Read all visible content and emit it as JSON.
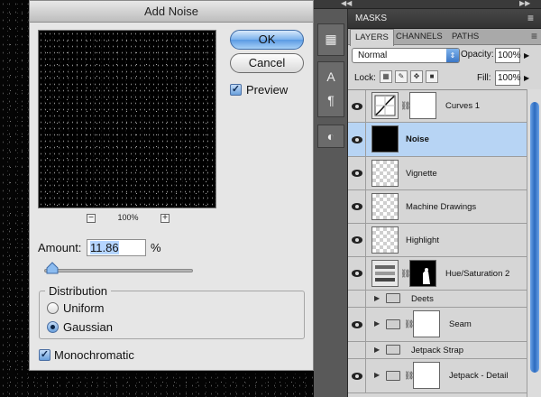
{
  "dialog": {
    "title": "Add Noise",
    "ok_label": "OK",
    "cancel_label": "Cancel",
    "preview_label": "Preview",
    "preview_checked": true,
    "zoom_level": "100%",
    "zoom_out_glyph": "−",
    "zoom_in_glyph": "+",
    "amount_label": "Amount:",
    "amount_value": "11.86",
    "amount_unit": "%",
    "amount_slider_fraction": 0.0297,
    "distribution_label": "Distribution",
    "uniform_label": "Uniform",
    "gaussian_label": "Gaussian",
    "selected_distribution": "Gaussian",
    "monochromatic_label": "Monochromatic",
    "monochromatic_checked": true
  },
  "panels": {
    "masks_label": "MASKS",
    "tabs": [
      "LAYERS",
      "CHANNELS",
      "PATHS"
    ],
    "active_tab": "LAYERS",
    "blend_mode": "Normal",
    "opacity_label": "Opacity:",
    "opacity_value": "100%",
    "lock_label": "Lock:",
    "fill_label": "Fill:",
    "fill_value": "100%"
  },
  "layers": [
    {
      "name": "Curves 1",
      "kind": "adjustment",
      "visible": true,
      "selected": false
    },
    {
      "name": "Noise",
      "kind": "fill-black",
      "visible": true,
      "selected": true
    },
    {
      "name": "Vignette",
      "kind": "transparent",
      "visible": true,
      "selected": false
    },
    {
      "name": "Machine Drawings",
      "kind": "transparent",
      "visible": true,
      "selected": false
    },
    {
      "name": "Highlight",
      "kind": "transparent",
      "visible": true,
      "selected": false
    },
    {
      "name": "Hue/Saturation 2",
      "kind": "adjustment",
      "visible": true,
      "selected": false
    },
    {
      "name": "Deets",
      "kind": "group",
      "visible": false,
      "selected": false
    },
    {
      "name": "Seam",
      "kind": "group-masked",
      "visible": true,
      "selected": false
    },
    {
      "name": "Jetpack Strap",
      "kind": "group",
      "visible": false,
      "selected": false
    },
    {
      "name": "Jetpack - Detail",
      "kind": "group-masked",
      "visible": true,
      "selected": false
    }
  ],
  "icons": {
    "eye": "eye-icon",
    "chain": "link-icon",
    "folder": "folder-icon",
    "disclosure": "triangle-right-icon"
  },
  "colors": {
    "selected_row": "#b7d4f4",
    "ok_button": "#5a9ae3"
  }
}
